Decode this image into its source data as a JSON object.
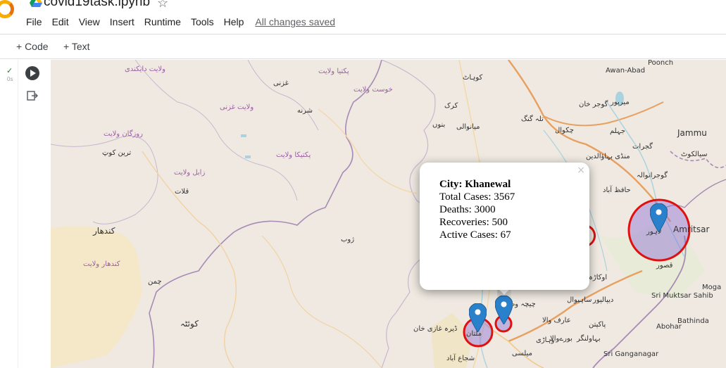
{
  "notebook": {
    "title": "covid19task.ipynb",
    "menu": [
      "File",
      "Edit",
      "View",
      "Insert",
      "Runtime",
      "Tools",
      "Help"
    ],
    "saved_status": "All changes saved"
  },
  "toolbar": {
    "code_label": "+ Code",
    "text_label": "+ Text"
  },
  "cell": {
    "exec_time": "0s"
  },
  "map": {
    "labels": [
      {
        "text": "ولایت دایکندی",
        "cls": "purple"
      },
      {
        "text": "غزنی",
        "cls": "dark"
      },
      {
        "text": "پکتیا ولایت",
        "cls": "purple"
      },
      {
        "text": "خوست ولایت",
        "cls": "purple"
      },
      {
        "text": "ولایت غزنی",
        "cls": "purple"
      },
      {
        "text": "شرنه",
        "cls": "dark"
      },
      {
        "text": "روزگان ولایت",
        "cls": "purple"
      },
      {
        "text": "ترین کوټ",
        "cls": "dark"
      },
      {
        "text": "پکتیکا ولایت",
        "cls": "purple"
      },
      {
        "text": "زابل ولایت",
        "cls": "purple"
      },
      {
        "text": "قلات",
        "cls": "dark"
      },
      {
        "text": "کندهار",
        "cls": "big"
      },
      {
        "text": "کندهار ولایت",
        "cls": "purple"
      },
      {
        "text": "ژوب",
        "cls": "dark"
      },
      {
        "text": "چمن",
        "cls": "dark"
      },
      {
        "text": "کوئٹہ",
        "cls": "big"
      },
      {
        "text": "کوہاٹ",
        "cls": "dark"
      },
      {
        "text": "کرک",
        "cls": "dark"
      },
      {
        "text": "بنوں",
        "cls": "dark"
      },
      {
        "text": "میانوالی",
        "cls": "dark"
      },
      {
        "text": "تلہ گنگ",
        "cls": "dark"
      },
      {
        "text": "چکوال",
        "cls": "dark"
      },
      {
        "text": "گوجر خان",
        "cls": "dark"
      },
      {
        "text": "میرپور",
        "cls": "dark"
      },
      {
        "text": "Awan-Abad",
        "cls": "dark"
      },
      {
        "text": "Poonch",
        "cls": "dark"
      },
      {
        "text": "Jammu",
        "cls": "big"
      },
      {
        "text": "Amritsar",
        "cls": "big"
      },
      {
        "text": "Moga",
        "cls": "dark"
      },
      {
        "text": "Sri Muktsar Sahib",
        "cls": "dark"
      },
      {
        "text": "Abohar",
        "cls": "dark"
      },
      {
        "text": "Bathinda",
        "cls": "dark"
      },
      {
        "text": "Sri Ganganagar",
        "cls": "dark"
      },
      {
        "text": "گوجرانوالہ",
        "cls": "dark"
      },
      {
        "text": "سیالکوٹ",
        "cls": "dark"
      },
      {
        "text": "قصور",
        "cls": "dark"
      },
      {
        "text": "ساہیوال",
        "cls": "dark"
      },
      {
        "text": "پاکپتن",
        "cls": "dark"
      },
      {
        "text": "بہاولنگر",
        "cls": "dark"
      },
      {
        "text": "ملتان",
        "cls": "dark"
      },
      {
        "text": "ڈیرہ غازی خان",
        "cls": "dark"
      },
      {
        "text": "شجاع آباد",
        "cls": "dark"
      },
      {
        "text": "لاہور",
        "cls": "dark"
      },
      {
        "text": "حافظ آباد",
        "cls": "dark"
      },
      {
        "text": "منڈی بہاؤالدین",
        "cls": "dark"
      },
      {
        "text": "جہلم",
        "cls": "dark"
      },
      {
        "text": "گجرات",
        "cls": "dark"
      },
      {
        "text": "وہاڑی",
        "cls": "dark"
      },
      {
        "text": "میلسی",
        "cls": "dark"
      },
      {
        "text": "چیچہ وطنی",
        "cls": "dark"
      },
      {
        "text": "اوکاڑہ",
        "cls": "dark"
      },
      {
        "text": "دیپالپور",
        "cls": "dark"
      },
      {
        "text": "عارف والا",
        "cls": "dark"
      },
      {
        "text": "بورےوالا",
        "cls": "dark"
      }
    ],
    "markers": [
      {
        "city": "Lahore",
        "color": "#2a81cb"
      },
      {
        "city": "Multan",
        "color": "#2a81cb"
      },
      {
        "city": "Khanewal",
        "color": "#2a81cb"
      }
    ],
    "popup": {
      "city_label": "City:",
      "city": "Khanewal",
      "total_cases": "Total Cases: 3567",
      "deaths": "Deaths: 3000",
      "recoveries": "Recoveries: 500",
      "active": "Active Cases: 67",
      "close": "×"
    }
  }
}
